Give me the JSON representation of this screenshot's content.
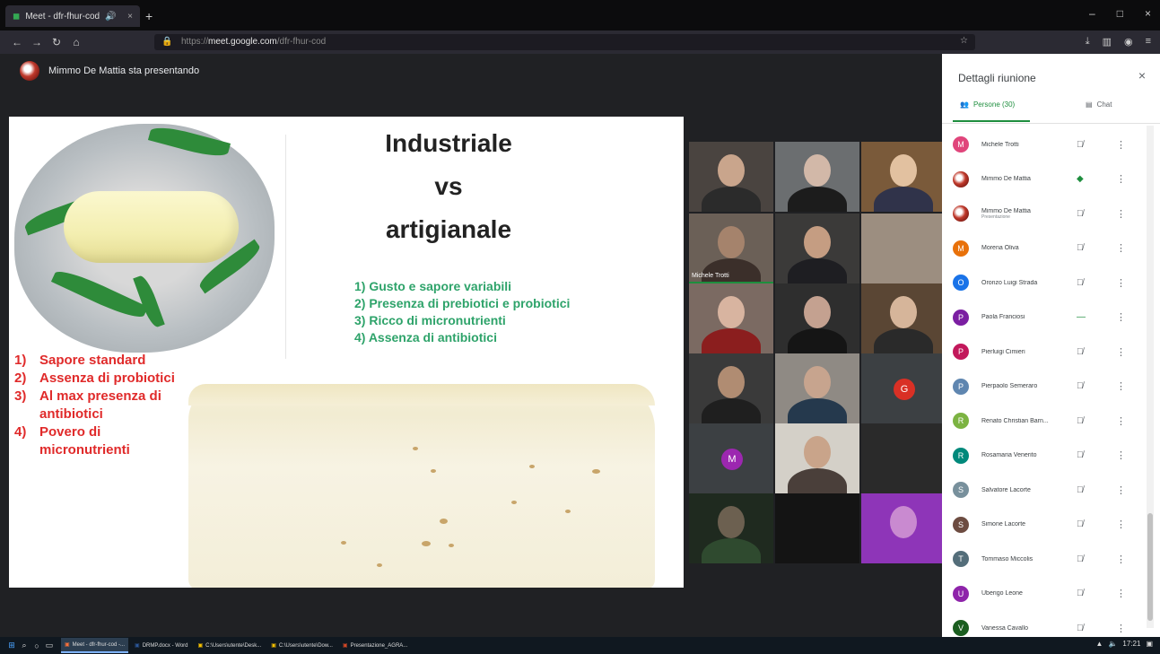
{
  "browser": {
    "tab_title": "Meet - dfr-fhur-cod",
    "new_tab": "+",
    "url_prefix": "https://",
    "url_host": "meet.google.com",
    "url_path": "/dfr-fhur-cod",
    "window_min": "–",
    "window_max": "□",
    "window_close": "×"
  },
  "meet": {
    "presenter_text": "Mimmo De Mattia sta presentando"
  },
  "slide": {
    "title_line1": "Industriale",
    "title_line2": "vs",
    "title_line3": "artigianale",
    "artigianale_items": [
      "1)  Gusto  e sapore variabili",
      "2)  Presenza di prebiotici e probiotici",
      "3)  Ricco di micronutrienti",
      "4)  Assenza di antibiotici"
    ],
    "industriale_items": [
      {
        "num": "1)",
        "text": "Sapore standard"
      },
      {
        "num": "2)",
        "text": "Assenza di probiotici"
      },
      {
        "num": "3)",
        "text": "Al max presenza di"
      },
      {
        "num": "",
        "text": "antibiotici"
      },
      {
        "num": "4)",
        "text": "Povero di"
      },
      {
        "num": "",
        "text": "micronutrienti"
      }
    ]
  },
  "grid": {
    "tile_name_label": "Michele Trotti",
    "avatar_g": "G",
    "avatar_m": "M"
  },
  "panel": {
    "title": "Dettagli riunione",
    "close": "×",
    "tab_people": "Persone (30)",
    "tab_chat": "Chat",
    "participants": [
      {
        "name": "Michele Trotti",
        "initial": "M",
        "color": "#e0457b",
        "sub": "",
        "mic": "muted",
        "avatar": "letter"
      },
      {
        "name": "Mimmo De Mattia",
        "initial": "",
        "color": "",
        "sub": "",
        "mic": "active",
        "avatar": "pizza"
      },
      {
        "name": "Mimmo De Mattia",
        "initial": "",
        "color": "",
        "sub": "Presentazione",
        "mic": "muted",
        "avatar": "pizza"
      },
      {
        "name": "Morena Oliva",
        "initial": "M",
        "color": "#e8710a",
        "sub": "",
        "mic": "muted",
        "avatar": "letter"
      },
      {
        "name": "Oronzo Luigi Strada",
        "initial": "O",
        "color": "#1a73e8",
        "sub": "",
        "mic": "muted",
        "avatar": "letter"
      },
      {
        "name": "Paola Franciosi",
        "initial": "P",
        "color": "#7b1fa2",
        "sub": "",
        "mic": "dash",
        "avatar": "letter"
      },
      {
        "name": "Pierluigi Cimieri",
        "initial": "P",
        "color": "#c2185b",
        "sub": "",
        "mic": "muted",
        "avatar": "letter"
      },
      {
        "name": "Pierpaolo Semeraro",
        "initial": "P",
        "color": "#5f86b0",
        "sub": "",
        "mic": "muted",
        "avatar": "letter"
      },
      {
        "name": "Renato Christian Barn...",
        "initial": "R",
        "color": "#7cb342",
        "sub": "",
        "mic": "muted",
        "avatar": "letter"
      },
      {
        "name": "Rosamaria Venerito",
        "initial": "R",
        "color": "#00897b",
        "sub": "",
        "mic": "muted",
        "avatar": "letter"
      },
      {
        "name": "Salvatore Lacorte",
        "initial": "S",
        "color": "#78909c",
        "sub": "",
        "mic": "muted",
        "avatar": "letter"
      },
      {
        "name": "Simone Lacorte",
        "initial": "S",
        "color": "#6d4c41",
        "sub": "",
        "mic": "muted",
        "avatar": "letter"
      },
      {
        "name": "Tommaso Miccolis",
        "initial": "T",
        "color": "#546e7a",
        "sub": "",
        "mic": "muted",
        "avatar": "letter"
      },
      {
        "name": "Uberigo Leone",
        "initial": "U",
        "color": "#8e24aa",
        "sub": "",
        "mic": "muted",
        "avatar": "letter"
      },
      {
        "name": "Vanessa Cavallo",
        "initial": "V",
        "color": "#1b5e20",
        "sub": "",
        "mic": "muted",
        "avatar": "letter"
      }
    ]
  },
  "taskbar": {
    "apps": [
      {
        "label": "Meet - dfr-fhur-cod -...",
        "active": true
      },
      {
        "label": "DRMP.docx - Word",
        "active": false
      },
      {
        "label": "C:\\Users\\utente\\Desk...",
        "active": false
      },
      {
        "label": "C:\\Users\\utente\\Dow...",
        "active": false
      },
      {
        "label": "Presentazione_AGRA...",
        "active": false
      }
    ],
    "clock": "17:21"
  },
  "colors": {
    "meet_green": "#1e8e3e",
    "industrial_red": "#e02a2a",
    "artisanal_green": "#2ea36a"
  }
}
